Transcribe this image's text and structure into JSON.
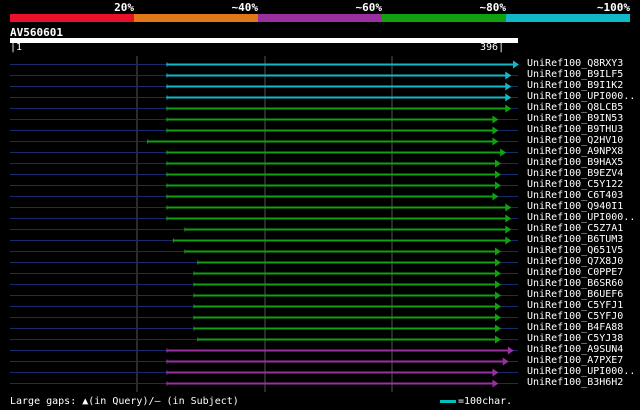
{
  "query": {
    "name": "AV560601",
    "start": "1",
    "end": "396"
  },
  "scale": [
    {
      "label": "20%",
      "color": "#e8102a"
    },
    {
      "label": "~40%",
      "color": "#e07818"
    },
    {
      "label": "~60%",
      "color": "#9a30a0"
    },
    {
      "label": "~80%",
      "color": "#10a010"
    },
    {
      "label": "~100%",
      "color": "#10b8c8"
    }
  ],
  "query_length": 396,
  "hits": [
    {
      "label": "UniRef100_Q8RXY3",
      "start": 1,
      "end": 396,
      "hit_start": 123,
      "hit_end": 396,
      "color": "#10b8c8"
    },
    {
      "label": "UniRef100_B9ILF5",
      "start": 1,
      "end": 396,
      "hit_start": 123,
      "hit_end": 390,
      "color": "#10b8c8"
    },
    {
      "label": "UniRef100_B9I1K2",
      "start": 1,
      "end": 396,
      "hit_start": 123,
      "hit_end": 390,
      "color": "#10b8c8"
    },
    {
      "label": "UniRef100_UPI000..",
      "start": 1,
      "end": 396,
      "hit_start": 123,
      "hit_end": 390,
      "color": "#10b8c8"
    },
    {
      "label": "UniRef100_Q8LCB5",
      "start": 1,
      "end": 396,
      "hit_start": 123,
      "hit_end": 390,
      "color": "#10a010"
    },
    {
      "label": "UniRef100_B9IN53",
      "start": 1,
      "end": 396,
      "hit_start": 123,
      "hit_end": 380,
      "color": "#10a010"
    },
    {
      "label": "UniRef100_B9THU3",
      "start": 1,
      "end": 396,
      "hit_start": 123,
      "hit_end": 380,
      "color": "#10a010"
    },
    {
      "label": "UniRef100_Q2HV10",
      "start": 1,
      "end": 396,
      "hit_start": 108,
      "hit_end": 380,
      "color": "#10a010"
    },
    {
      "label": "UniRef100_A9NPX8",
      "start": 1,
      "end": 396,
      "hit_start": 123,
      "hit_end": 386,
      "color": "#10a010"
    },
    {
      "label": "UniRef100_B9HAX5",
      "start": 1,
      "end": 396,
      "hit_start": 123,
      "hit_end": 382,
      "color": "#10a010"
    },
    {
      "label": "UniRef100_B9EZV4",
      "start": 1,
      "end": 396,
      "hit_start": 123,
      "hit_end": 382,
      "color": "#10a010"
    },
    {
      "label": "UniRef100_C5Y122",
      "start": 1,
      "end": 396,
      "hit_start": 123,
      "hit_end": 382,
      "color": "#10a010"
    },
    {
      "label": "UniRef100_C6T403",
      "start": 1,
      "end": 396,
      "hit_start": 123,
      "hit_end": 380,
      "color": "#10a010"
    },
    {
      "label": "UniRef100_Q940I1",
      "start": 1,
      "end": 396,
      "hit_start": 123,
      "hit_end": 390,
      "color": "#10a010"
    },
    {
      "label": "UniRef100_UPI000..",
      "start": 1,
      "end": 396,
      "hit_start": 123,
      "hit_end": 390,
      "color": "#10a010"
    },
    {
      "label": "UniRef100_C5Z7A1",
      "start": 1,
      "end": 396,
      "hit_start": 137,
      "hit_end": 390,
      "color": "#10a010"
    },
    {
      "label": "UniRef100_B6TUM3",
      "start": 1,
      "end": 396,
      "hit_start": 128,
      "hit_end": 390,
      "color": "#10a010"
    },
    {
      "label": "UniRef100_Q651V5",
      "start": 1,
      "end": 396,
      "hit_start": 137,
      "hit_end": 382,
      "color": "#10a010"
    },
    {
      "label": "UniRef100_Q7X8J0",
      "start": 1,
      "end": 396,
      "hit_start": 147,
      "hit_end": 382,
      "color": "#10a010"
    },
    {
      "label": "UniRef100_C0PPE7",
      "start": 1,
      "end": 396,
      "hit_start": 144,
      "hit_end": 382,
      "color": "#10a010"
    },
    {
      "label": "UniRef100_B6SR60",
      "start": 1,
      "end": 396,
      "hit_start": 144,
      "hit_end": 382,
      "color": "#10a010"
    },
    {
      "label": "UniRef100_B6UEF6",
      "start": 1,
      "end": 396,
      "hit_start": 144,
      "hit_end": 382,
      "color": "#10a010"
    },
    {
      "label": "UniRef100_C5YFJ1",
      "start": 1,
      "end": 396,
      "hit_start": 144,
      "hit_end": 382,
      "color": "#10a010"
    },
    {
      "label": "UniRef100_C5YFJ0",
      "start": 1,
      "end": 396,
      "hit_start": 144,
      "hit_end": 382,
      "color": "#10a010"
    },
    {
      "label": "UniRef100_B4FA88",
      "start": 1,
      "end": 396,
      "hit_start": 144,
      "hit_end": 382,
      "color": "#10a010"
    },
    {
      "label": "UniRef100_C5YJ38",
      "start": 1,
      "end": 396,
      "hit_start": 147,
      "hit_end": 382,
      "color": "#10a010"
    },
    {
      "label": "UniRef100_A9SUN4",
      "start": 1,
      "end": 396,
      "hit_start": 123,
      "hit_end": 392,
      "color": "#9a30a0"
    },
    {
      "label": "UniRef100_A7PXE7",
      "start": 1,
      "end": 396,
      "hit_start": 123,
      "hit_end": 388,
      "color": "#9a30a0"
    },
    {
      "label": "UniRef100_UPI000..",
      "start": 1,
      "end": 396,
      "hit_start": 123,
      "hit_end": 380,
      "color": "#9a30a0"
    },
    {
      "label": "UniRef100_B3H6H2",
      "start": 1,
      "end": 396,
      "hit_start": 123,
      "hit_end": 380,
      "color": "#9a30a0"
    }
  ],
  "footer": {
    "gaps_text": "Large gaps: ▲(in Query)/– (in Subject)",
    "key_text": "=100char."
  },
  "colors": {
    "background": "#000000",
    "track": "#1a2a6a",
    "grid": "#555555",
    "query_bar": "#ffffff"
  }
}
